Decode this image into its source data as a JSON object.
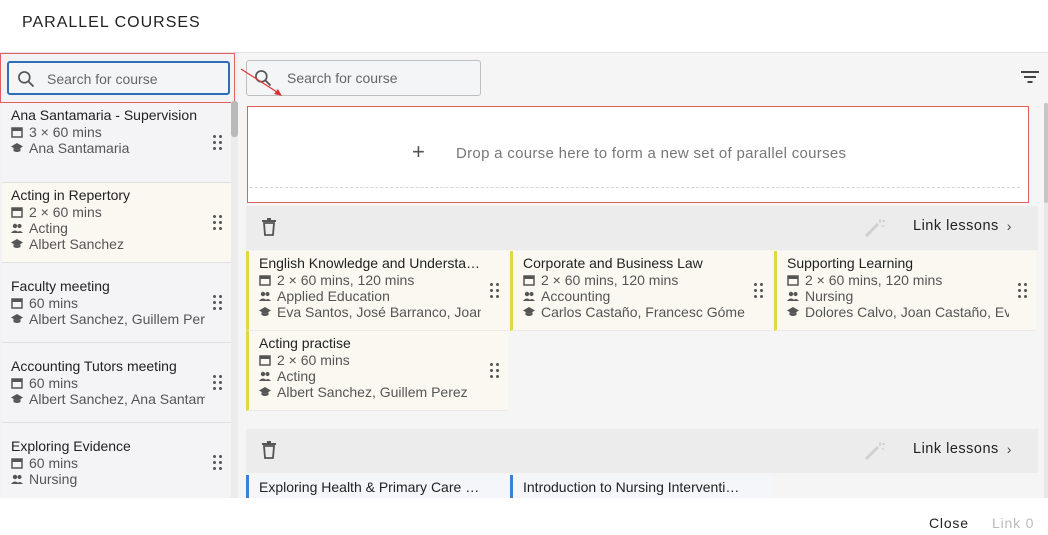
{
  "dialog": {
    "title": "PARALLEL COURSES"
  },
  "left": {
    "search_placeholder": "Search for course",
    "courses": [
      {
        "name": "Ana Santamaria - Supervision",
        "sessions": "3 × 60 mins",
        "people": "Ana Santamaria"
      },
      {
        "name": "Acting in Repertory",
        "sessions": "2 × 60 mins",
        "group": "Acting",
        "people": "Albert Sanchez"
      },
      {
        "name": "Faculty meeting",
        "sessions": "60 mins",
        "people": "Albert Sanchez, Guillem Perez"
      },
      {
        "name": "Accounting Tutors meeting",
        "sessions": "60 mins",
        "people": "Albert Sanchez, Ana Santamaria"
      },
      {
        "name": "Exploring Evidence",
        "sessions": "60 mins",
        "group": "Nursing"
      }
    ]
  },
  "right": {
    "search_placeholder": "Search for course",
    "drop_zone": {
      "plus": "+",
      "text": "Drop a course here to form a new set of parallel courses"
    },
    "groups": [
      {
        "link_label": "Link lessons",
        "courses": [
          {
            "name": "English Knowledge and Understanding",
            "sessions": "2 × 60 mins, 120 mins",
            "group": "Applied Education",
            "people": "Eva Santos, José Barranco, Joan Castaño"
          },
          {
            "name": "Corporate and Business Law",
            "sessions": "2 × 60 mins, 120 mins",
            "group": "Accounting",
            "people": "Carlos Castaño, Francesc Gómez"
          },
          {
            "name": "Supporting Learning",
            "sessions": "2 × 60 mins, 120 mins",
            "group": "Nursing",
            "people": "Dolores Calvo, Joan Castaño, Eva Santos"
          },
          {
            "name": "Acting practise",
            "sessions": "2 × 60 mins",
            "group": "Acting",
            "people": "Albert Sanchez, Guillem Perez"
          }
        ]
      },
      {
        "link_label": "Link lessons",
        "courses": [
          {
            "name": "Exploring Health & Primary Care Services"
          },
          {
            "name": "Introduction to Nursing Interventions"
          }
        ]
      }
    ]
  },
  "footer": {
    "close_label": "Close",
    "link_label": "Link 0"
  },
  "colors": {
    "accent_blue": "#2f6db5",
    "highlight_red": "#e06060",
    "card_yellow": "#e5d54a",
    "card_blue": "#3b7fd6"
  }
}
